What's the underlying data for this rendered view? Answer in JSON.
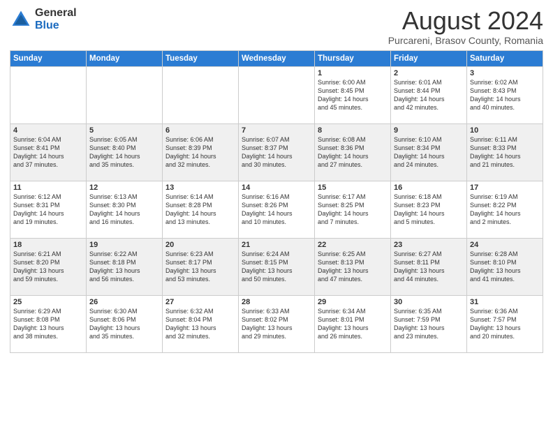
{
  "header": {
    "logo_general": "General",
    "logo_blue": "Blue",
    "month": "August 2024",
    "location": "Purcareni, Brasov County, Romania"
  },
  "weekdays": [
    "Sunday",
    "Monday",
    "Tuesday",
    "Wednesday",
    "Thursday",
    "Friday",
    "Saturday"
  ],
  "weeks": [
    [
      {
        "day": "",
        "info": ""
      },
      {
        "day": "",
        "info": ""
      },
      {
        "day": "",
        "info": ""
      },
      {
        "day": "",
        "info": ""
      },
      {
        "day": "1",
        "info": "Sunrise: 6:00 AM\nSunset: 8:45 PM\nDaylight: 14 hours\nand 45 minutes."
      },
      {
        "day": "2",
        "info": "Sunrise: 6:01 AM\nSunset: 8:44 PM\nDaylight: 14 hours\nand 42 minutes."
      },
      {
        "day": "3",
        "info": "Sunrise: 6:02 AM\nSunset: 8:43 PM\nDaylight: 14 hours\nand 40 minutes."
      }
    ],
    [
      {
        "day": "4",
        "info": "Sunrise: 6:04 AM\nSunset: 8:41 PM\nDaylight: 14 hours\nand 37 minutes."
      },
      {
        "day": "5",
        "info": "Sunrise: 6:05 AM\nSunset: 8:40 PM\nDaylight: 14 hours\nand 35 minutes."
      },
      {
        "day": "6",
        "info": "Sunrise: 6:06 AM\nSunset: 8:39 PM\nDaylight: 14 hours\nand 32 minutes."
      },
      {
        "day": "7",
        "info": "Sunrise: 6:07 AM\nSunset: 8:37 PM\nDaylight: 14 hours\nand 30 minutes."
      },
      {
        "day": "8",
        "info": "Sunrise: 6:08 AM\nSunset: 8:36 PM\nDaylight: 14 hours\nand 27 minutes."
      },
      {
        "day": "9",
        "info": "Sunrise: 6:10 AM\nSunset: 8:34 PM\nDaylight: 14 hours\nand 24 minutes."
      },
      {
        "day": "10",
        "info": "Sunrise: 6:11 AM\nSunset: 8:33 PM\nDaylight: 14 hours\nand 21 minutes."
      }
    ],
    [
      {
        "day": "11",
        "info": "Sunrise: 6:12 AM\nSunset: 8:31 PM\nDaylight: 14 hours\nand 19 minutes."
      },
      {
        "day": "12",
        "info": "Sunrise: 6:13 AM\nSunset: 8:30 PM\nDaylight: 14 hours\nand 16 minutes."
      },
      {
        "day": "13",
        "info": "Sunrise: 6:14 AM\nSunset: 8:28 PM\nDaylight: 14 hours\nand 13 minutes."
      },
      {
        "day": "14",
        "info": "Sunrise: 6:16 AM\nSunset: 8:26 PM\nDaylight: 14 hours\nand 10 minutes."
      },
      {
        "day": "15",
        "info": "Sunrise: 6:17 AM\nSunset: 8:25 PM\nDaylight: 14 hours\nand 7 minutes."
      },
      {
        "day": "16",
        "info": "Sunrise: 6:18 AM\nSunset: 8:23 PM\nDaylight: 14 hours\nand 5 minutes."
      },
      {
        "day": "17",
        "info": "Sunrise: 6:19 AM\nSunset: 8:22 PM\nDaylight: 14 hours\nand 2 minutes."
      }
    ],
    [
      {
        "day": "18",
        "info": "Sunrise: 6:21 AM\nSunset: 8:20 PM\nDaylight: 13 hours\nand 59 minutes."
      },
      {
        "day": "19",
        "info": "Sunrise: 6:22 AM\nSunset: 8:18 PM\nDaylight: 13 hours\nand 56 minutes."
      },
      {
        "day": "20",
        "info": "Sunrise: 6:23 AM\nSunset: 8:17 PM\nDaylight: 13 hours\nand 53 minutes."
      },
      {
        "day": "21",
        "info": "Sunrise: 6:24 AM\nSunset: 8:15 PM\nDaylight: 13 hours\nand 50 minutes."
      },
      {
        "day": "22",
        "info": "Sunrise: 6:25 AM\nSunset: 8:13 PM\nDaylight: 13 hours\nand 47 minutes."
      },
      {
        "day": "23",
        "info": "Sunrise: 6:27 AM\nSunset: 8:11 PM\nDaylight: 13 hours\nand 44 minutes."
      },
      {
        "day": "24",
        "info": "Sunrise: 6:28 AM\nSunset: 8:10 PM\nDaylight: 13 hours\nand 41 minutes."
      }
    ],
    [
      {
        "day": "25",
        "info": "Sunrise: 6:29 AM\nSunset: 8:08 PM\nDaylight: 13 hours\nand 38 minutes."
      },
      {
        "day": "26",
        "info": "Sunrise: 6:30 AM\nSunset: 8:06 PM\nDaylight: 13 hours\nand 35 minutes."
      },
      {
        "day": "27",
        "info": "Sunrise: 6:32 AM\nSunset: 8:04 PM\nDaylight: 13 hours\nand 32 minutes."
      },
      {
        "day": "28",
        "info": "Sunrise: 6:33 AM\nSunset: 8:02 PM\nDaylight: 13 hours\nand 29 minutes."
      },
      {
        "day": "29",
        "info": "Sunrise: 6:34 AM\nSunset: 8:01 PM\nDaylight: 13 hours\nand 26 minutes."
      },
      {
        "day": "30",
        "info": "Sunrise: 6:35 AM\nSunset: 7:59 PM\nDaylight: 13 hours\nand 23 minutes."
      },
      {
        "day": "31",
        "info": "Sunrise: 6:36 AM\nSunset: 7:57 PM\nDaylight: 13 hours\nand 20 minutes."
      }
    ]
  ]
}
